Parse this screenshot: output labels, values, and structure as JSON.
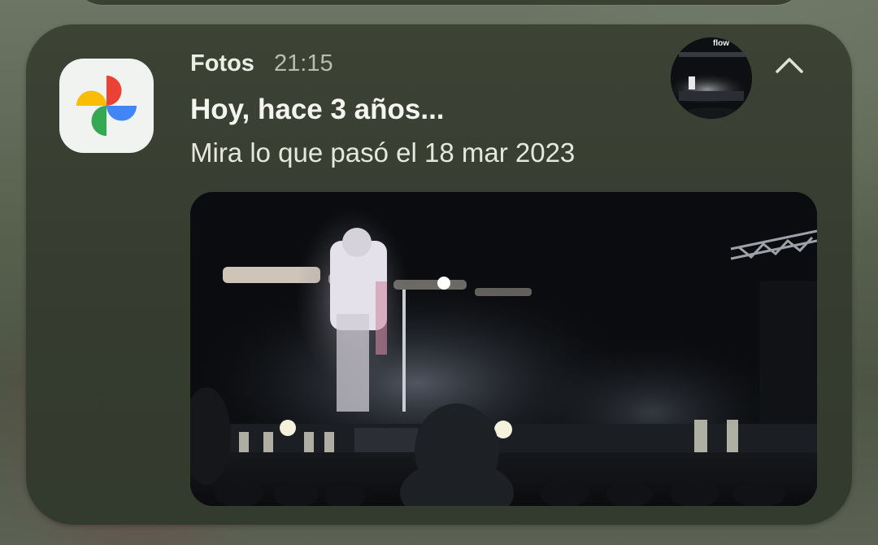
{
  "notification": {
    "app_name": "Fotos",
    "time": "21:15",
    "title": "Hoy, hace 3 años...",
    "body": "Mira lo que pasó el 18 mar 2023",
    "thumbnail_label": "flow"
  },
  "icons": {
    "app_icon": "google-photos-pinwheel-icon",
    "collapse": "chevron-up-icon"
  },
  "colors": {
    "pinwheel_red": "#ea4335",
    "pinwheel_yellow": "#fbbc04",
    "pinwheel_green": "#34a853",
    "pinwheel_blue": "#4285f4"
  }
}
